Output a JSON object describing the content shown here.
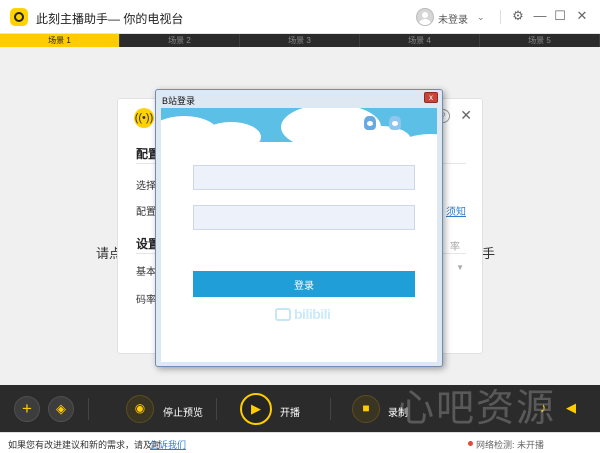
{
  "window": {
    "title": "此刻主播助手",
    "subtitle": "— 你的电视台",
    "user_label": "未登录",
    "minimize": "—",
    "maximize": "☐",
    "close": "✕",
    "settings_glyph": "⚙",
    "caret": "⌄"
  },
  "scenes": [
    {
      "label": "场景 1",
      "active": true
    },
    {
      "label": "场景 2",
      "active": false
    },
    {
      "label": "场景 3",
      "active": false
    },
    {
      "label": "场景 4",
      "active": false
    },
    {
      "label": "场景 5",
      "active": false
    }
  ],
  "main": {
    "hint_left": "请点",
    "hint_right": "手"
  },
  "settings_card": {
    "section1": "配置",
    "row_select": "选择",
    "row_config": "配置",
    "link": "须知",
    "section2": "设置",
    "row_basic": "基本",
    "faint_rate": "率",
    "row_bitrate": "码率",
    "help_glyph": "?",
    "close_glyph": "✕"
  },
  "login_dialog": {
    "title": "B站登录",
    "close_glyph": "x",
    "username_value": "",
    "password_value": "",
    "login_button": "登录",
    "brand": "bilibili"
  },
  "bottombar": {
    "add_glyph": "+",
    "layers_glyph": "◈",
    "stop_preview": "停止预览",
    "start_live": "开播",
    "record": "录制",
    "watermark": "心吧资源"
  },
  "statusbar": {
    "feedback_text": "如果您有改进建议和新的需求，请及时",
    "feedback_link": "告诉我们",
    "network": "网络检测: 未开播"
  },
  "colors": {
    "accent": "#ffcc00",
    "dark_bar": "#2b2b2b",
    "login_blue": "#1f9ed8",
    "link_blue": "#2d7fd3"
  }
}
